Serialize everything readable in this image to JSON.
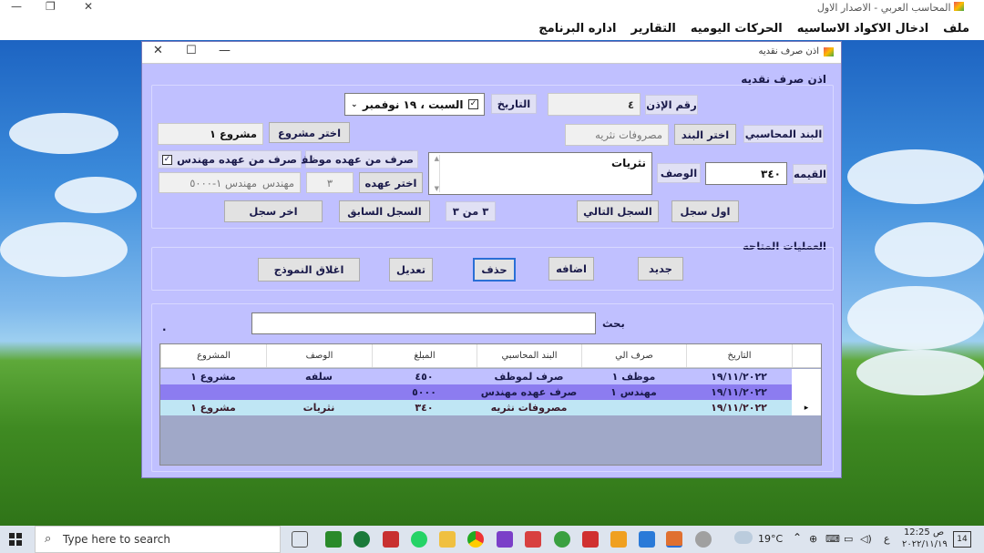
{
  "app": {
    "title": "المحاسب العربي - الاصدار الاول",
    "menu": [
      "ملف",
      "ادخال الاكواد الاساسيه",
      "الحركات اليوميه",
      "التقارير",
      "اداره البرنامج"
    ]
  },
  "window": {
    "title": "اذن صرف نقديه",
    "section_title": "اذن صرف نقديه",
    "ops_title": "العمليات المتاحه"
  },
  "form": {
    "permit_no_label": "رقم الإذن",
    "permit_no": "٤",
    "date_label": "التاريخ",
    "date_value": "السبت ، ١٩ نوفمبر",
    "item_label": "البند المحاسبي",
    "choose_item": "اختر البند",
    "item_value": "مصروفات نثريه",
    "choose_project": "اختر مشروع",
    "project_value": "مشروع ١",
    "value_label": "القيمه",
    "value": "٣٤٠",
    "desc_label": "الوصف",
    "desc_value": "نثريات",
    "emp_custody": "صرف من عهده موظف",
    "eng_custody_header": "صرف من عهده مهندس",
    "eng_custody": "صرف من عهده مهندس",
    "choose_custody": "اختر عهده",
    "custody_id": "٣",
    "custody_name": "مهندس ١-٥٠٠٠",
    "custody_prefix": "مهندس"
  },
  "nav": {
    "first": "اول سجل",
    "next": "السجل التالي",
    "record_pos": "٣ من ٣",
    "prev": "السجل السابق",
    "last": "اخر سجل"
  },
  "ops": {
    "new": "جديد",
    "add": "اضافه",
    "delete": "حذف",
    "edit": "تعديل",
    "close": "اغلاق النموذج"
  },
  "search": {
    "label": "بحث",
    "value": "",
    "dot": "."
  },
  "grid": {
    "headers": [
      "التاريخ",
      "صرف الي",
      "البند المحاسبي",
      "المبلغ",
      "الوصف",
      "المشروع"
    ],
    "rows": [
      [
        "١٩/١١/٢٠٢٢",
        "موظف ١",
        "صرف لموظف",
        "٤٥٠",
        "سلفه",
        "مشروع ١"
      ],
      [
        "١٩/١١/٢٠٢٢",
        "مهندس ١",
        "صرف عهده مهندس",
        "٥٠٠٠",
        "",
        ""
      ],
      [
        "١٩/١١/٢٠٢٢",
        "",
        "مصروفات نثريه",
        "٣٤٠",
        "نثريات",
        "مشروع ١"
      ]
    ],
    "current_marker": "▸"
  },
  "taskbar": {
    "search_placeholder": "Type here to search",
    "weather": "19°C",
    "time": "12:25",
    "ampm": "ص",
    "date": "٢٠٢٢/١١/١٩",
    "lang": "ع",
    "notif": "14"
  }
}
